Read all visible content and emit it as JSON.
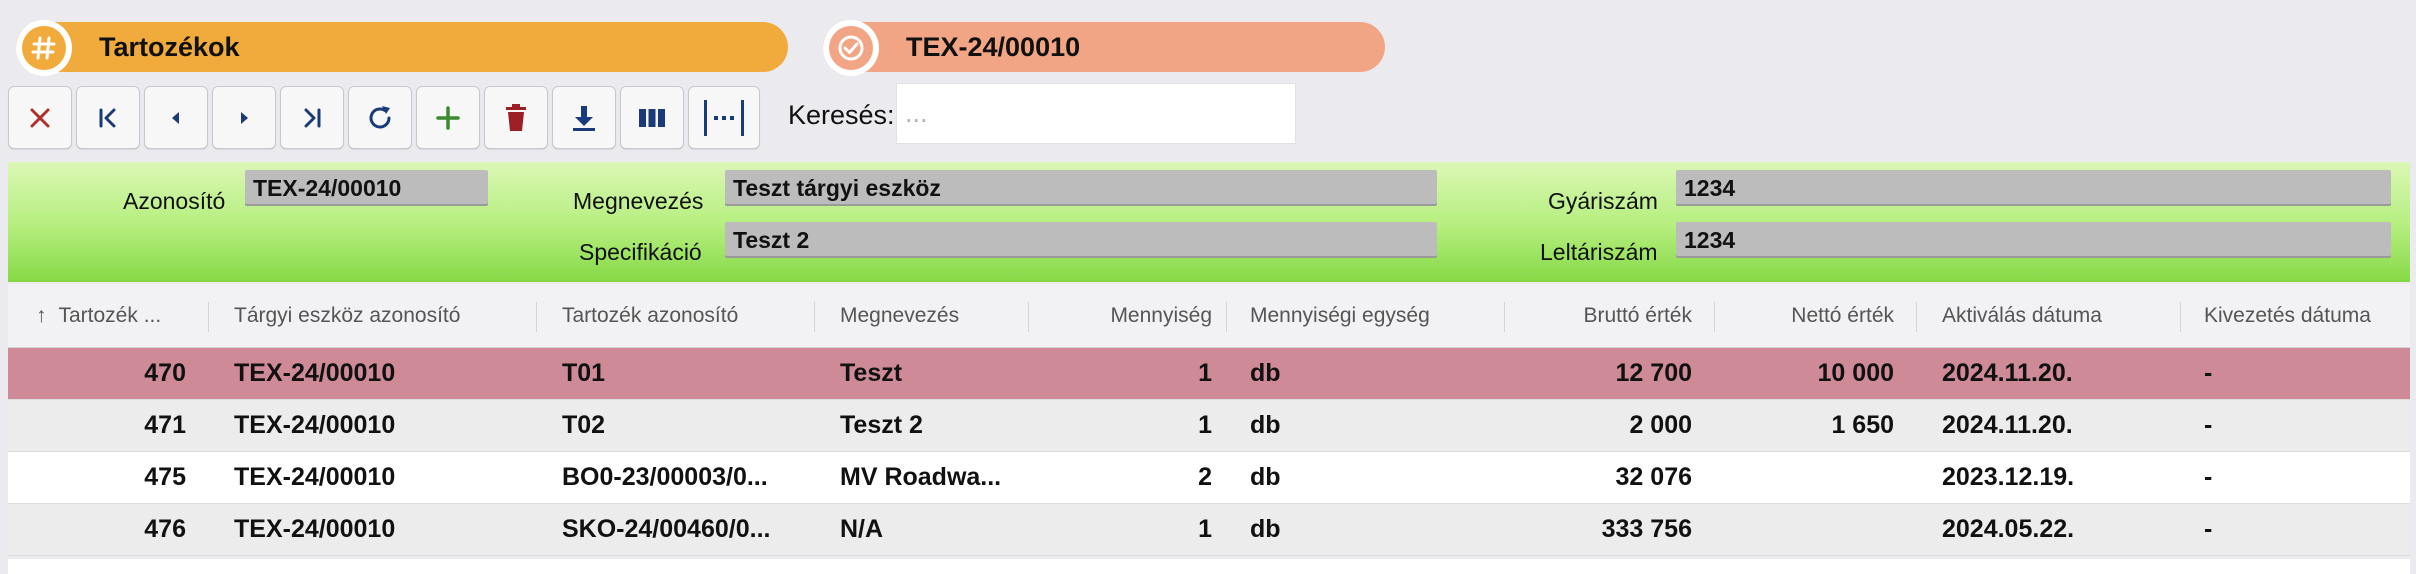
{
  "header": {
    "module_title": "Tartozékok",
    "module_icon": "hash-icon",
    "record_title": "TEX-24/00010",
    "record_icon": "check-badge-icon"
  },
  "toolbar": {
    "buttons": [
      "close-icon",
      "first-record-icon",
      "previous-record-icon",
      "next-record-icon",
      "last-record-icon",
      "refresh-icon",
      "add-icon",
      "delete-icon",
      "download-icon",
      "columns-icon",
      "fit-width-icon"
    ],
    "search_label": "Keresés:",
    "search_placeholder": "..."
  },
  "form": {
    "azonosito_label": "Azonosító",
    "azonosito_value": "TEX-24/00010",
    "megnevezes_label": "Megnevezés",
    "megnevezes_value": "Teszt tárgyi eszköz",
    "specifikacio_label": "Specifikáció",
    "specifikacio_value": "Teszt 2",
    "gyariszam_label": "Gyáriszám",
    "gyariszam_value": "1234",
    "leltariszam_label": "Leltáriszám",
    "leltariszam_value": "1234"
  },
  "table": {
    "sort_indicator": "↑",
    "columns": [
      "Tartozék ...",
      "Tárgyi eszköz azonosító",
      "Tartozék azonosító",
      "Megnevezés",
      "Mennyiség",
      "Mennyiségi egység",
      "Bruttó érték",
      "Nettó érték",
      "Aktiválás dátuma",
      "Kivezetés dátuma"
    ],
    "rows": [
      [
        "470",
        "TEX-24/00010",
        "T01",
        "Teszt",
        "1",
        "db",
        "12 700",
        "10 000",
        "2024.11.20.",
        "-"
      ],
      [
        "471",
        "TEX-24/00010",
        "T02",
        "Teszt 2",
        "1",
        "db",
        "2 000",
        "1 650",
        "2024.11.20.",
        "-"
      ],
      [
        "475",
        "TEX-24/00010",
        "BO0-23/00003/0...",
        "MV Roadwa...",
        "2",
        "db",
        "32 076",
        "",
        "2023.12.19.",
        "-"
      ],
      [
        "476",
        "TEX-24/00010",
        "SKO-24/00460/0...",
        "N/A",
        "1",
        "db",
        "333 756",
        "",
        "2024.05.22.",
        "-"
      ]
    ]
  },
  "colors": {
    "module_pill": "#f1ab3c",
    "record_pill": "#f2a584",
    "form_panel": "#b4ee7d",
    "selected_row": "#ce8a96"
  }
}
